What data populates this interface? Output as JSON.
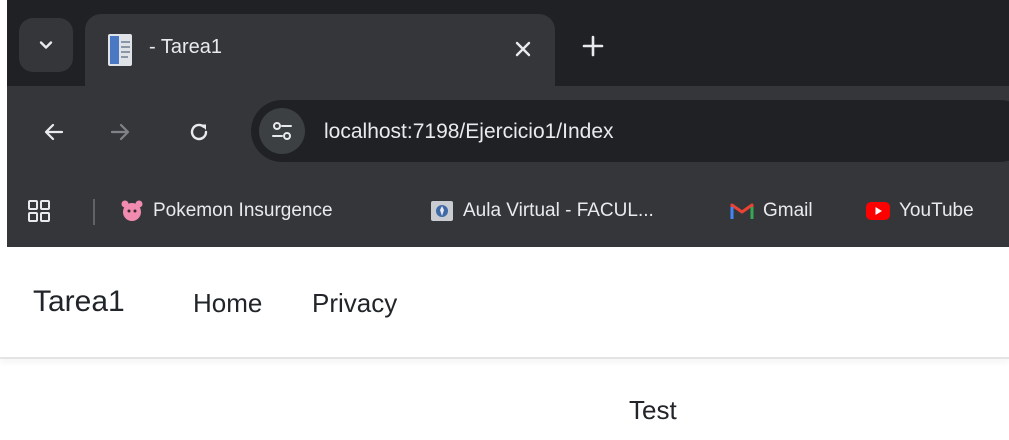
{
  "browser": {
    "tab": {
      "title": " - Tarea1"
    },
    "address_bar": {
      "url": "localhost:7198/Ejercicio1/Index"
    },
    "bookmarks": [
      {
        "label": "Pokemon Insurgence",
        "icon": "pokemon-icon"
      },
      {
        "label": "Aula Virtual - FACUL...",
        "icon": "university-icon"
      },
      {
        "label": "Gmail",
        "icon": "gmail-icon"
      },
      {
        "label": "YouTube",
        "icon": "youtube-icon"
      }
    ],
    "colors": {
      "frame": "#202124",
      "toolbar": "#35363a",
      "text": "#e8eaed"
    }
  },
  "navbar": {
    "brand": "Tarea1",
    "links": [
      {
        "label": "Home"
      },
      {
        "label": "Privacy"
      }
    ]
  },
  "main": {
    "text": "Test"
  }
}
